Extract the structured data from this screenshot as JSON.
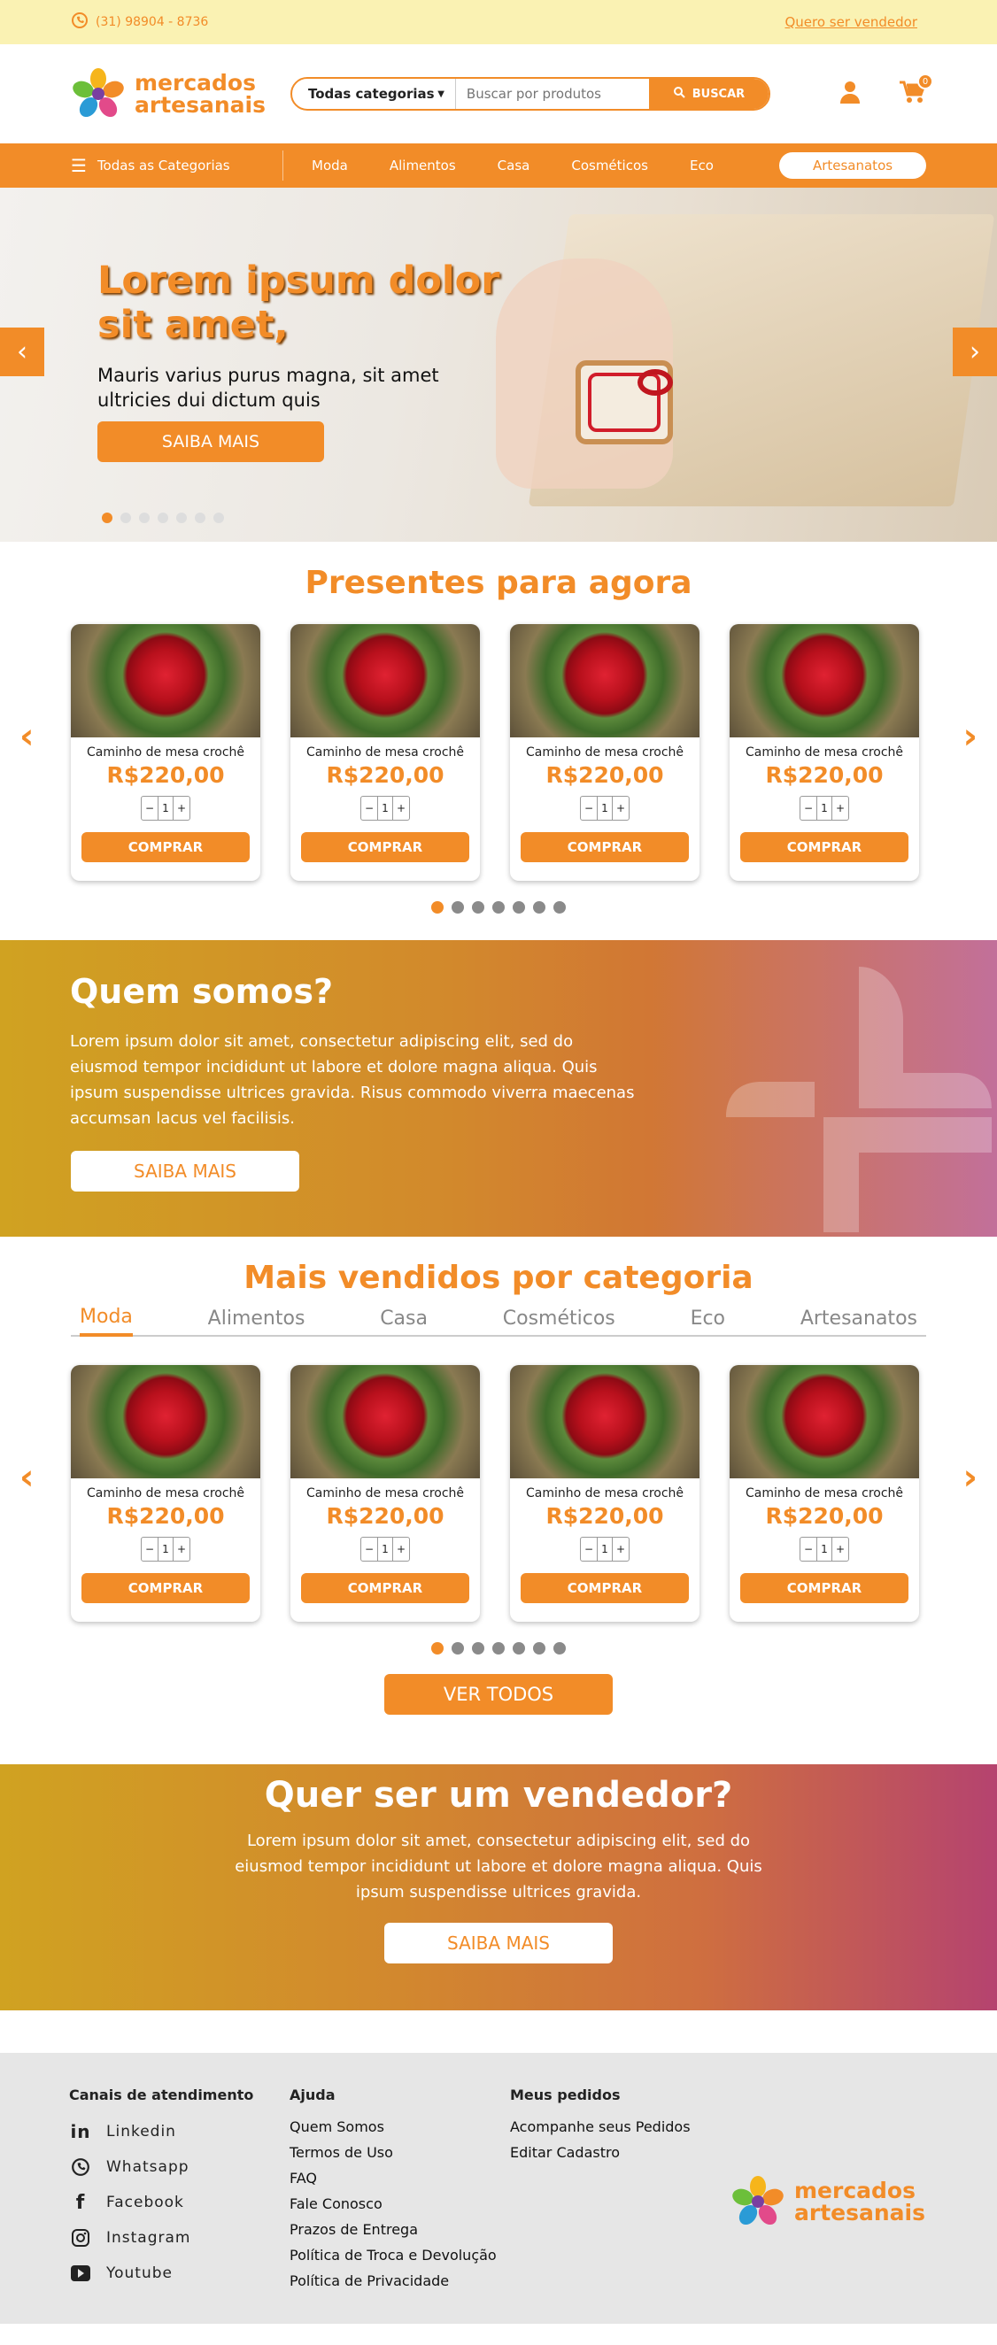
{
  "topbar": {
    "phone": "(31) 98904 - 8736",
    "sell_link": "Quero ser vendedor"
  },
  "header": {
    "logo_line1": "mercados",
    "logo_line2": "artesanais",
    "category_select": "Todas categorias",
    "search_placeholder": "Buscar por produtos",
    "search_button": "BUSCAR",
    "cart_count": "0"
  },
  "nav": {
    "all_label": "Todas as Categorias",
    "items": [
      "Moda",
      "Alimentos",
      "Casa",
      "Cosméticos",
      "Eco"
    ],
    "highlight": "Artesanatos"
  },
  "hero": {
    "title": "Lorem ipsum dolor sit amet,",
    "subtitle": "Mauris varius purus magna, sit amet ultricies dui dictum quis",
    "cta": "SAIBA MAIS",
    "slides": 7,
    "active_slide": 1
  },
  "gifts": {
    "title": "Presentes para agora",
    "products": [
      {
        "name": "Caminho de mesa crochê",
        "price": "R$220,00",
        "qty": "1",
        "buy": "COMPRAR"
      },
      {
        "name": "Caminho de mesa crochê",
        "price": "R$220,00",
        "qty": "1",
        "buy": "COMPRAR"
      },
      {
        "name": "Caminho de mesa crochê",
        "price": "R$220,00",
        "qty": "1",
        "buy": "COMPRAR"
      },
      {
        "name": "Caminho de mesa crochê",
        "price": "R$220,00",
        "qty": "1",
        "buy": "COMPRAR"
      }
    ],
    "pages": 7,
    "active_page": 1
  },
  "about": {
    "title": "Quem somos?",
    "text": "Lorem ipsum dolor sit amet, consectetur adipiscing elit, sed do eiusmod tempor incididunt ut labore et dolore magna aliqua. Quis ipsum suspendisse ultrices gravida. Risus commodo viverra maecenas accumsan lacus vel facilisis.",
    "button": "SAIBA MAIS"
  },
  "best": {
    "title": "Mais vendidos por categoria",
    "tabs": [
      "Moda",
      "Alimentos",
      "Casa",
      "Cosméticos",
      "Eco",
      "Artesanatos"
    ],
    "active_tab": "Moda",
    "products": [
      {
        "name": "Caminho de mesa crochê",
        "price": "R$220,00",
        "qty": "1",
        "buy": "COMPRAR"
      },
      {
        "name": "Caminho de mesa crochê",
        "price": "R$220,00",
        "qty": "1",
        "buy": "COMPRAR"
      },
      {
        "name": "Caminho de mesa crochê",
        "price": "R$220,00",
        "qty": "1",
        "buy": "COMPRAR"
      },
      {
        "name": "Caminho de mesa crochê",
        "price": "R$220,00",
        "qty": "1",
        "buy": "COMPRAR"
      }
    ],
    "pages": 7,
    "active_page": 1,
    "see_all": "VER TODOS"
  },
  "seller": {
    "title": "Quer ser um vendedor?",
    "text": "Lorem ipsum dolor sit amet, consectetur adipiscing elit, sed do eiusmod tempor incididunt ut labore et dolore magna aliqua. Quis ipsum suspendisse ultrices gravida.",
    "button": "SAIBA MAIS"
  },
  "footer": {
    "support": {
      "title": "Canais de atendimento",
      "items": [
        "Linkedin",
        "Whatsapp",
        "Facebook",
        "Instagram",
        "Youtube"
      ]
    },
    "help": {
      "title": "Ajuda",
      "items": [
        "Quem Somos",
        "Termos de Uso",
        "FAQ",
        "Fale Conosco",
        "Prazos de Entrega",
        "Política de Troca e Devolução",
        "Política de Privacidade"
      ]
    },
    "orders": {
      "title": "Meus pedidos",
      "items": [
        "Acompanhe seus Pedidos",
        "Editar Cadastro"
      ]
    },
    "logo_line1": "mercados",
    "logo_line2": "artesanais"
  },
  "colors": {
    "accent": "#f28c28",
    "topbar": "#faf2b3",
    "footer": "#e6e6e6"
  }
}
